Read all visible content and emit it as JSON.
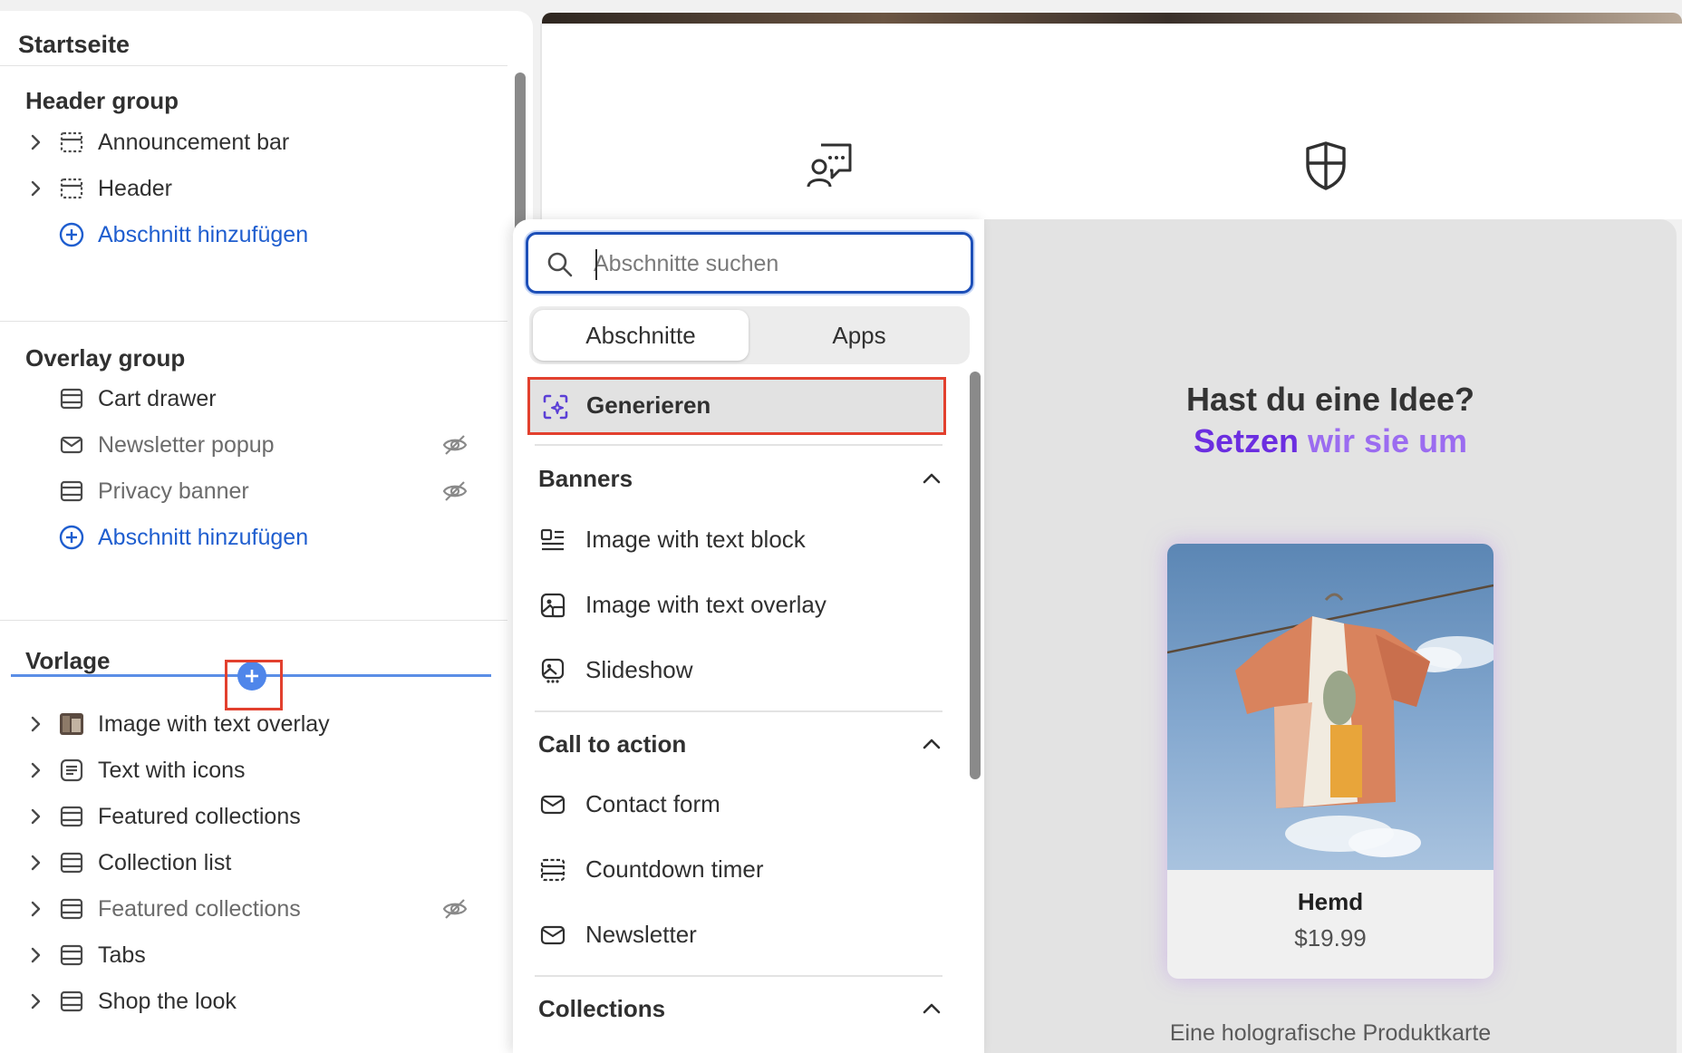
{
  "sidebar": {
    "title": "Startseite",
    "groups": [
      {
        "heading": "Header group",
        "items": [
          {
            "label": "Announcement bar",
            "icon": "section-dashed-icon",
            "hidden": false
          },
          {
            "label": "Header",
            "icon": "section-dashed-icon",
            "hidden": false
          }
        ],
        "add_label": "Abschnitt hinzufügen"
      },
      {
        "heading": "Overlay group",
        "items": [
          {
            "label": "Cart drawer",
            "icon": "section-rows-icon",
            "hidden": false
          },
          {
            "label": "Newsletter popup",
            "icon": "envelope-icon",
            "hidden": true
          },
          {
            "label": "Privacy banner",
            "icon": "section-rows-icon",
            "hidden": true
          }
        ],
        "add_label": "Abschnitt hinzufügen"
      },
      {
        "heading": "Vorlage",
        "items": [
          {
            "label": "Image with text overlay",
            "icon": "image-thumbnail-icon",
            "hidden": false
          },
          {
            "label": "Text with icons",
            "icon": "text-block-icon",
            "hidden": false
          },
          {
            "label": "Featured collections",
            "icon": "section-rows-icon",
            "hidden": false
          },
          {
            "label": "Collection list",
            "icon": "section-rows-icon",
            "hidden": false
          },
          {
            "label": "Featured collections",
            "icon": "section-rows-icon",
            "hidden": true
          },
          {
            "label": "Tabs",
            "icon": "section-rows-icon",
            "hidden": false
          },
          {
            "label": "Shop the look",
            "icon": "section-rows-icon",
            "hidden": false
          }
        ]
      }
    ]
  },
  "popover": {
    "search": {
      "placeholder": "Abschnitte suchen",
      "value": ""
    },
    "tabs": {
      "sections": "Abschnitte",
      "apps": "Apps",
      "active": "Abschnitte"
    },
    "generate_label": "Generieren",
    "categories": [
      {
        "heading": "Banners",
        "items": [
          {
            "label": "Image with text block",
            "icon": "image-text-block-icon"
          },
          {
            "label": "Image with text overlay",
            "icon": "image-overlay-icon"
          },
          {
            "label": "Slideshow",
            "icon": "slideshow-icon"
          }
        ]
      },
      {
        "heading": "Call to action",
        "items": [
          {
            "label": "Contact form",
            "icon": "envelope-icon"
          },
          {
            "label": "Countdown timer",
            "icon": "section-rows-icon"
          },
          {
            "label": "Newsletter",
            "icon": "envelope-icon"
          }
        ]
      },
      {
        "heading": "Collections",
        "items": []
      }
    ]
  },
  "preview": {
    "idea_title": "Hast du eine Idee?",
    "idea_sub_part1": "Setzen",
    "idea_sub_part2": "wir sie um",
    "product": {
      "name": "Hemd",
      "price": "$19.99"
    },
    "caption": "Eine holografische Produktkarte",
    "top_icons": [
      "chat-support-icon",
      "shield-icon"
    ]
  },
  "colors": {
    "accent_blue": "#1f5ecf",
    "highlight_red": "#e2402e",
    "purple": "#7b3fe4"
  }
}
